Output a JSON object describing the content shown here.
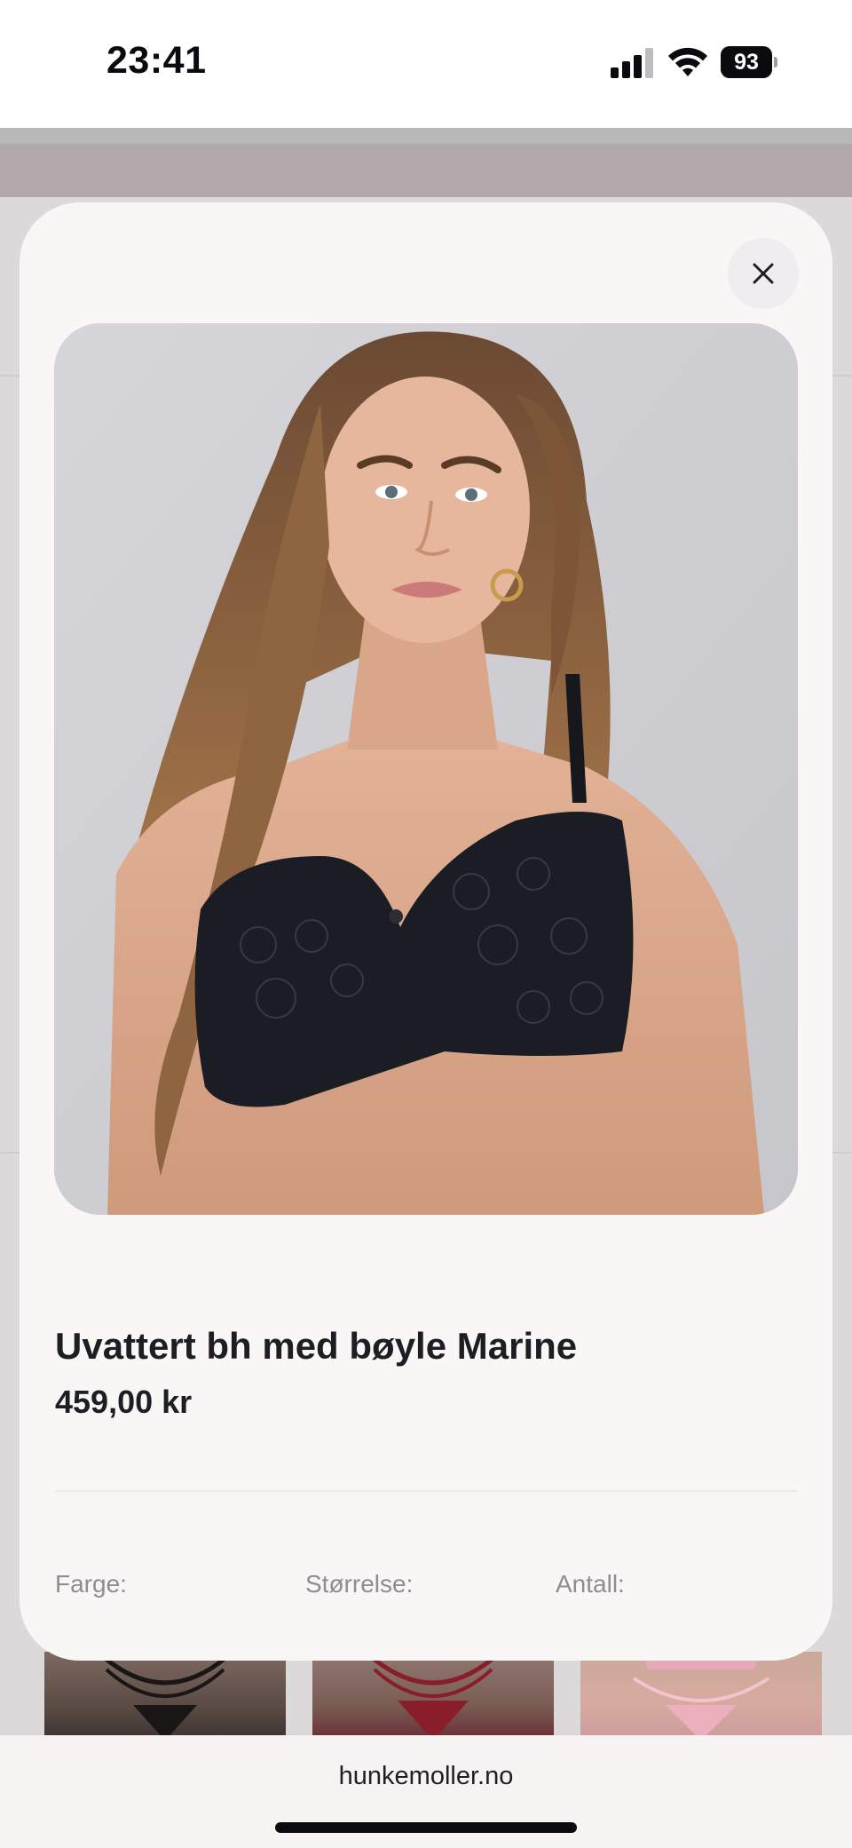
{
  "status_bar": {
    "time": "23:41",
    "battery_percent": "93",
    "icons": [
      "signal-icon",
      "wifi-icon",
      "battery-icon"
    ]
  },
  "modal": {
    "close_icon": "close-icon",
    "product": {
      "title": "Uvattert bh med bøyle Marine",
      "price": "459,00 kr",
      "image_alt": "product-photo"
    },
    "options": {
      "color_label": "Farge:",
      "size_label": "Størrelse:",
      "quantity_label": "Antall:"
    }
  },
  "browser": {
    "address": "hunkemoller.no"
  },
  "colors": {
    "modal_background": "#f9f6f6",
    "text_primary": "#1d1d23",
    "text_muted": "#8f8c92",
    "close_button_bg": "#f0edf1"
  }
}
